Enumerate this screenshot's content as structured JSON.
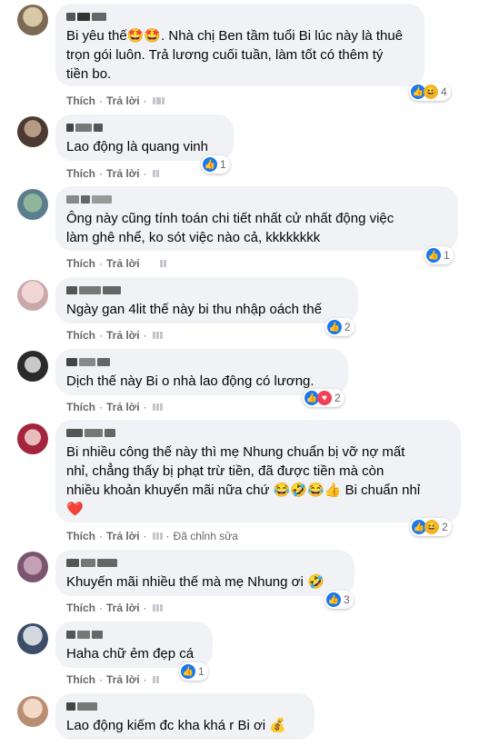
{
  "actions": {
    "like": "Thích",
    "reply": "Trả lời",
    "edited": "Đã chỉnh sửa"
  },
  "comments": [
    {
      "text": "Bi yêu thế🤩🤩. Nhà chị Ben tầm tuổi Bi lúc này là thuê\ntrọn gói luôn. Trả lương cuối tuần, làm tốt có thêm tý\ntiền bo.",
      "reactions": [
        "like",
        "haha"
      ],
      "count": "4"
    },
    {
      "text": "Lao động là quang vinh",
      "reactions": [
        "like"
      ],
      "count": "1"
    },
    {
      "text": "Ông này cũng tính toán chi tiết nhất cử nhất động việc\nlàm ghê nhể, ko sót việc nào cả, kkkkkkkk",
      "reactions": [
        "like"
      ],
      "count": "1"
    },
    {
      "text": "Ngày gan 4lit thế này bi thu nhập oách thế",
      "reactions": [
        "like"
      ],
      "count": "2"
    },
    {
      "text": "Dịch thế này Bi o nhà lao động có lương.",
      "reactions": [
        "like",
        "love"
      ],
      "count": "2"
    },
    {
      "text": "Bi nhiều công thế này thì mẹ Nhung chuẩn bị vỡ nợ mất\nnhỉ, chẳng thấy bị phạt trừ tiền, đã được tiền mà còn\nnhiều khoản khuyến mãi nữa chứ 😂🤣😂👍 Bi chuẩn nhỉ\n❤️",
      "reactions": [
        "like",
        "haha"
      ],
      "count": "2"
    },
    {
      "text": "Khuyến mãi nhiều thế mà mẹ Nhung ơi 🤣",
      "reactions": [
        "like"
      ],
      "count": "3"
    },
    {
      "text": "Haha chữ ẻm đẹp cá",
      "reactions": [
        "like"
      ],
      "count": "1"
    },
    {
      "text": "Lao động kiếm đc kha khá r Bi ơi 💰",
      "reactions": [],
      "count": ""
    }
  ]
}
